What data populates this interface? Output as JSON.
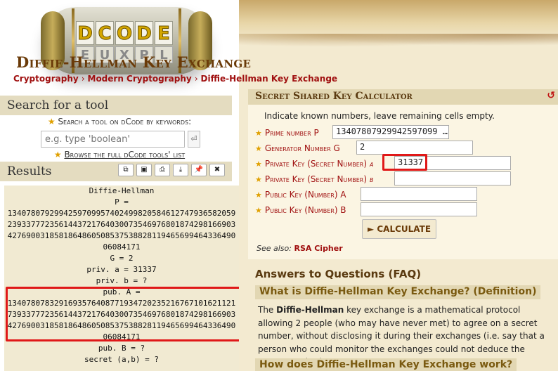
{
  "logo": {
    "main_letters": [
      "D",
      "C",
      "O",
      "D",
      "E"
    ],
    "sub_letters": [
      "E",
      "U",
      "X",
      "P",
      "L"
    ]
  },
  "left": {
    "search_title": "Search for a tool",
    "search_hint": "Search a tool on dCode by keywords:",
    "search_placeholder": "e.g. type 'boolean'",
    "browse_label": "Browse the full dCode tools' list",
    "results_title": "Results",
    "result_button_icons": [
      "copy-icon",
      "save-icon",
      "print-icon",
      "download-icon",
      "pin-icon",
      "close-icon"
    ],
    "results_lines": [
      "Diffie-Hellman",
      "P =",
      "1340780792994259709957402499820584612747936582059",
      "2393377723561443721764030073546976801874298166903",
      "4276900318581864860508537538828119465699464336490",
      "06084171",
      "G = 2",
      "priv. a = 31337",
      "priv. b = ?",
      "pub. A =",
      "1340780783291693576408771934720235216767101621121",
      "7393377723561443721764030073546976801874298166903",
      "4276900318581864860508537538828119465699464336490",
      "06084171",
      "pub. B = ?",
      "secret (a,b) = ?"
    ]
  },
  "right": {
    "title": "Diffie-Hellman Key Exchange",
    "breadcrumbs": [
      "Cryptography",
      "Modern Cryptography",
      "Diffie-Hellman Key Exchange"
    ],
    "calc_title": "Secret Shared Key Calculator",
    "note": "Indicate known numbers, leave remaining cells empty.",
    "fields": [
      {
        "label": "Prime number P",
        "var": "",
        "value": "13407807929942597099 …"
      },
      {
        "label": "Generator Number G",
        "var": "",
        "value": "2"
      },
      {
        "label": "Private Key (Secret Number)",
        "var": "a",
        "value": "31337"
      },
      {
        "label": "Private Key (Secret Number)",
        "var": "b",
        "value": ""
      },
      {
        "label": "Public Key (Number) A",
        "var": "",
        "value": ""
      },
      {
        "label": "Public Key (Number) B",
        "var": "",
        "value": ""
      }
    ],
    "calc_button": "► CALCULATE",
    "see_also_label": "See also:",
    "see_also_link": "RSA Cipher",
    "faq_title": "Answers to Questions (FAQ)",
    "q1": "What is Diffie-Hellman Key Exchange? (Definition)",
    "answer_bold": "Diffie-Hellman",
    "answer_rest": " key exchange is a mathematical protocol allowing 2 people (who may have never met) to agree on a secret number, without disclosing it during their exchanges (i.e. say that a person who could monitor the exchanges could not deduce the secret number).",
    "answer_prefix": "The ",
    "q2": "How does Diffie-Hellman Key Exchange work?"
  },
  "colors": {
    "accent_red": "#a01010",
    "highlight_red": "#e01818",
    "title_brown": "#6a3a08"
  }
}
